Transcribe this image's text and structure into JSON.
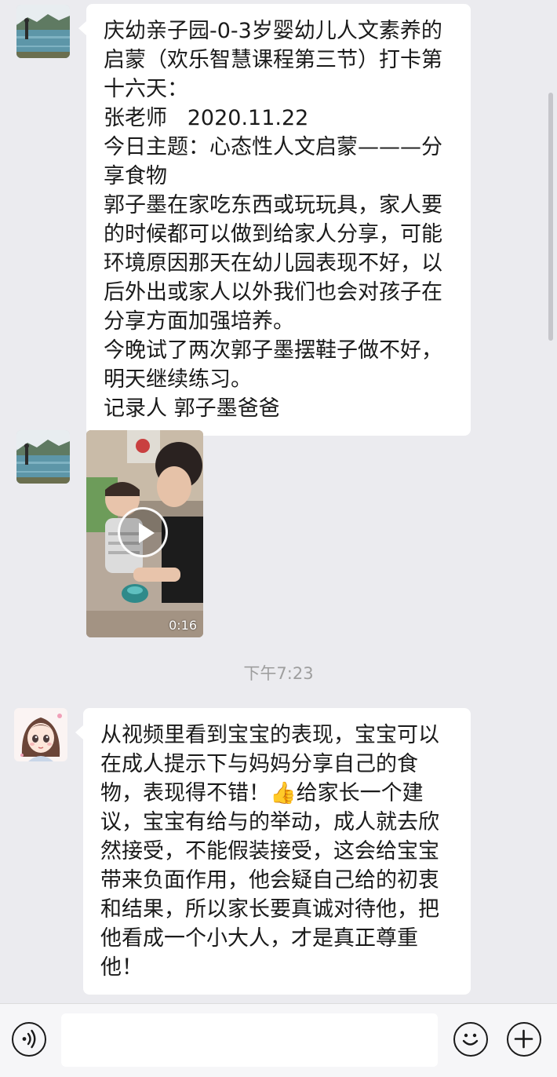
{
  "messages": [
    {
      "type": "text",
      "text": "庆幼亲子园-0-3岁婴幼儿人文素养的启蒙（欢乐智慧课程第三节）打卡第十六天：\n张老师   2020.11.22\n今日主题：心态性人文启蒙———分享食物\n郭子墨在家吃东西或玩玩具，家人要的时候都可以做到给家人分享，可能环境原因那天在幼儿园表现不好，以后外出或家人以外我们也会对孩子在分享方面加强培养。\n今晚试了两次郭子墨摆鞋子做不好，明天继续练习。\n记录人 郭子墨爸爸"
    },
    {
      "type": "video",
      "duration": "0:16"
    },
    {
      "type": "timestamp",
      "text": "下午7:23"
    },
    {
      "type": "text",
      "text": "从视频里看到宝宝的表现，宝宝可以在成人提示下与妈妈分享自己的食物，表现得不错！👍给家长一个建议，宝宝有给与的举动，成人就去欣然接受，不能假装接受，这会给宝宝带来负面作用，他会疑自己给的初衷和结果，所以家长要真诚对待他，把他看成一个小大人，才是真正尊重他！"
    }
  ],
  "input_bar": {
    "voice_icon": "voice-icon",
    "emoji_icon": "emoji-icon",
    "plus_icon": "plus-icon"
  },
  "colors": {
    "chat_background": "#ebebef",
    "bubble": "#ffffff",
    "timestamp_text": "#9e9e9e",
    "input_bar": "#f6f6f8"
  }
}
